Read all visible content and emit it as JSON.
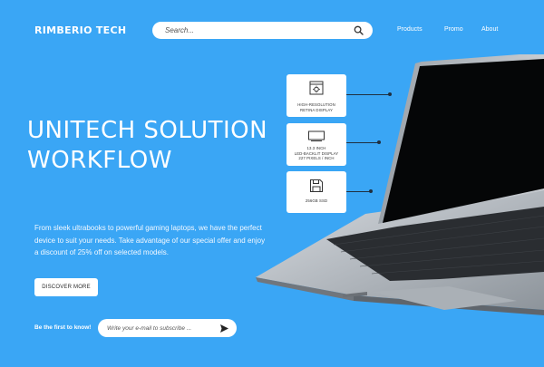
{
  "brand": {
    "logo_text": "RIMBERIO TECH"
  },
  "search": {
    "placeholder": "Search...",
    "icon": "search-icon"
  },
  "nav": {
    "items": [
      "Products",
      "Promo",
      "About"
    ]
  },
  "hero": {
    "title_line1": "UNITECH SOLUTION",
    "title_line2": "WORKFLOW",
    "description": "From sleek ultrabooks to powerful gaming laptops, we have the perfect device to suit your needs. Take advantage of our special offer and enjoy a discount of 25% off on selected models.",
    "cta_label": "DISCOVER MORE"
  },
  "newsletter": {
    "label": "Be the first to know!",
    "placeholder": "Write your e-mail to subscribe ...",
    "icon": "send-icon"
  },
  "specs": [
    {
      "icon": "display-settings-icon",
      "lines": [
        "HIGH-RESOLUTION",
        "RETINA DISPLAY"
      ]
    },
    {
      "icon": "monitor-icon",
      "lines": [
        "13.3 INCH",
        "LED-BACKLIT DISPLAY",
        "227 PIXELS / INCH"
      ]
    },
    {
      "icon": "floppy-disk-icon",
      "lines": [
        "256GB SSD"
      ]
    }
  ],
  "colors": {
    "background": "#3aa6f5",
    "card": "#ffffff",
    "text": "#ffffff",
    "connector": "#1f2f40"
  }
}
